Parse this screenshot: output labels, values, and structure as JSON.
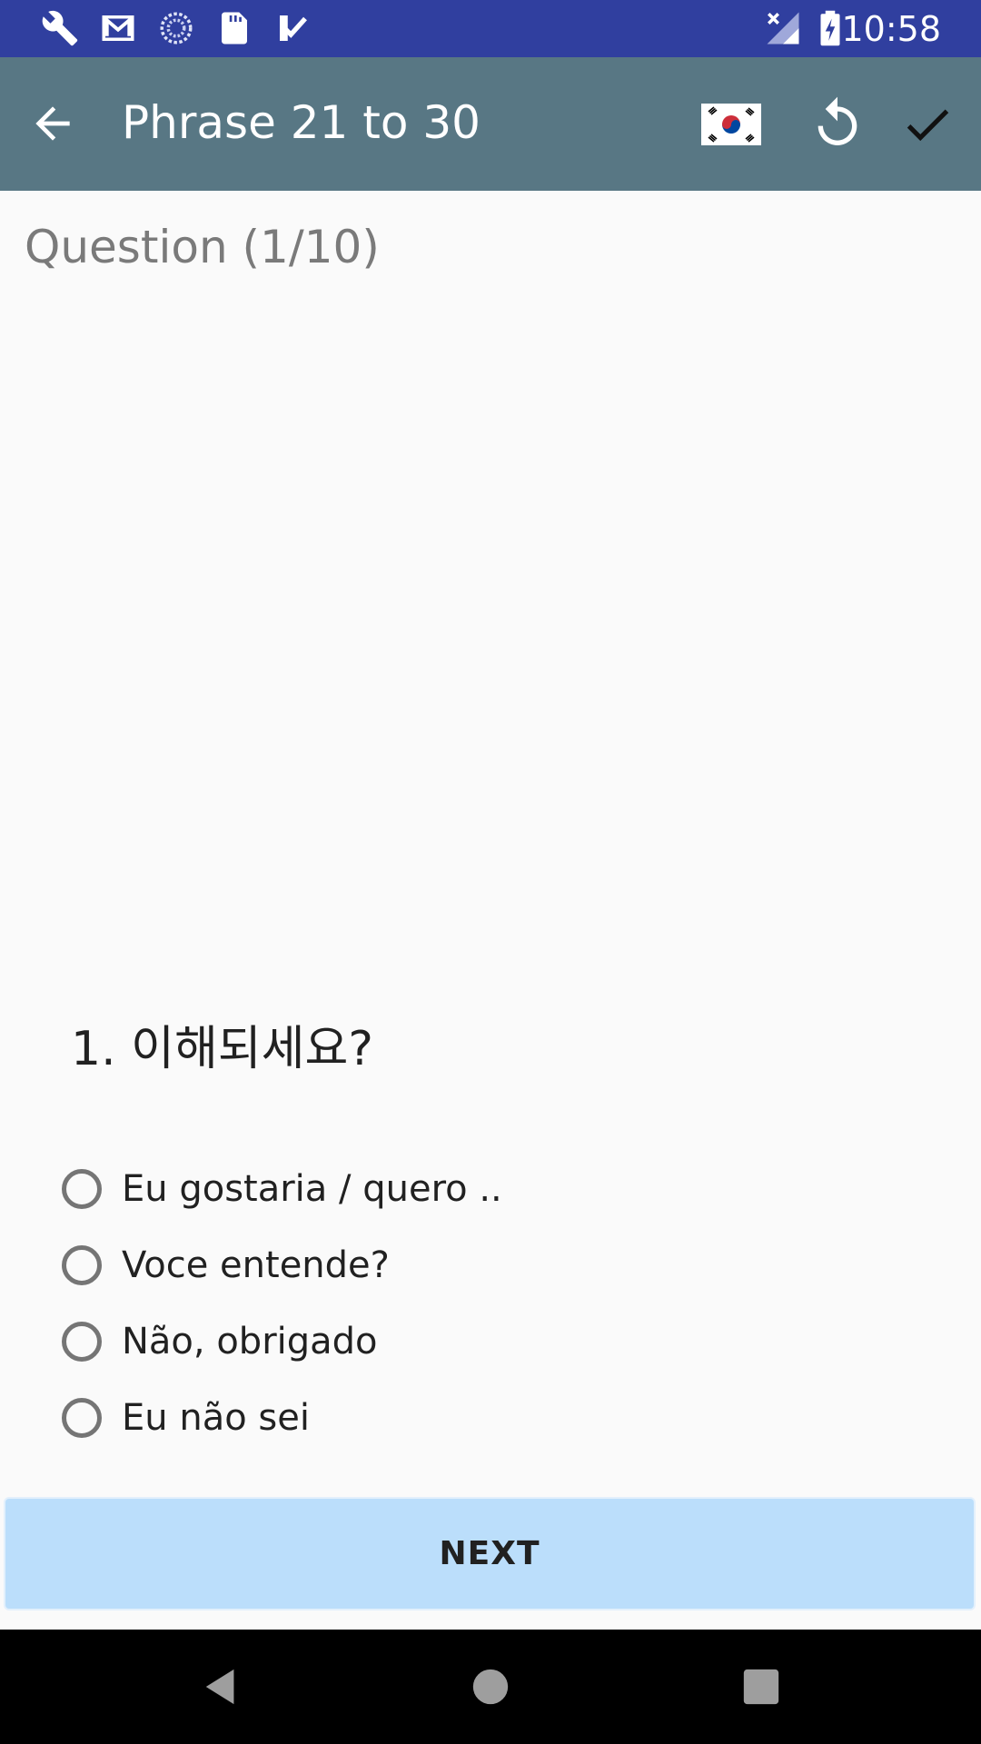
{
  "status_bar": {
    "time": "10:58",
    "left_icons": [
      "wrench-icon",
      "gmail-icon",
      "sync-icon",
      "sd-card-icon",
      "task-check-icon"
    ],
    "right_icons": [
      "no-signal-icon",
      "battery-charging-icon"
    ],
    "color": "#303f9f"
  },
  "app_bar": {
    "title": "Phrase 21 to 30",
    "back_icon": "arrow-back-icon",
    "flag_icon": "korean-flag-icon",
    "refresh_icon": "refresh-icon",
    "check_icon": "check-icon",
    "color": "#587784"
  },
  "quiz": {
    "progress_label": "Question (1/10)",
    "question": "1. 이해되세요?",
    "options": [
      "Eu gostaria / quero ..",
      "Voce entende?",
      "Não, obrigado",
      "Eu não sei"
    ],
    "next_label": "NEXT",
    "next_button_color": "#bbdefb"
  },
  "nav_bar": {
    "icons": [
      "nav-back-icon",
      "nav-home-icon",
      "nav-recents-icon"
    ]
  }
}
